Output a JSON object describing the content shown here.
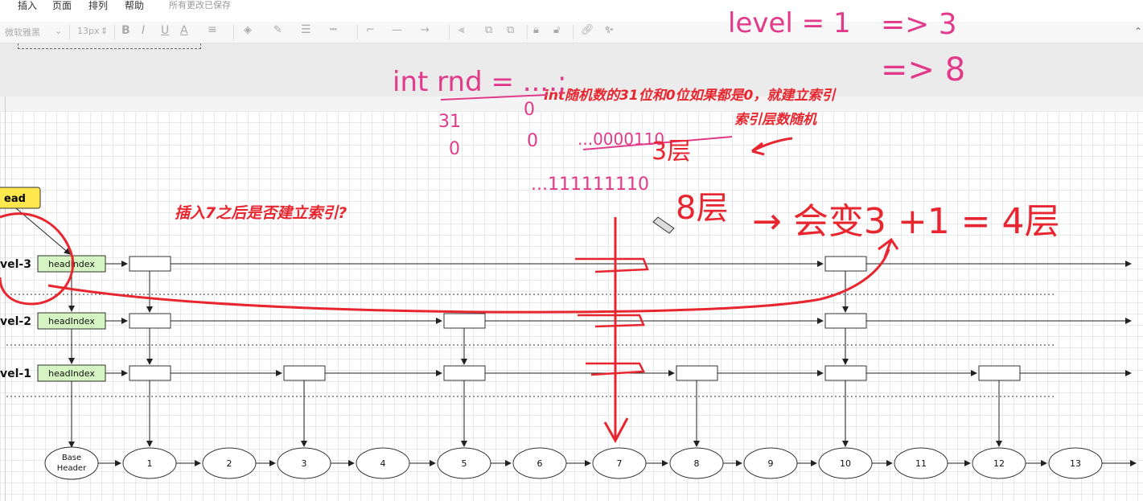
{
  "menu": {
    "items": [
      "插入",
      "页面",
      "排列",
      "帮助"
    ],
    "status": "所有更改已保存"
  },
  "toolbar": {
    "font_name": "微软雅黑",
    "font_size": "13px",
    "bold_icon": "B",
    "italic_icon": "I",
    "underline_icon": "U",
    "font_color_icon": "A"
  },
  "diagram": {
    "head_label": "ead",
    "level_labels": [
      "vel-3",
      "vel-2",
      "vel-1"
    ],
    "head_index_label": "headIndex",
    "base_header": [
      "Base",
      "Header"
    ],
    "nodes": [
      "1",
      "2",
      "3",
      "4",
      "5",
      "6",
      "7",
      "8",
      "9",
      "10",
      "11",
      "12",
      "13"
    ]
  },
  "annotations": {
    "typed_line1": "int随机数的31位和0位如果都是0，就建立索引",
    "typed_line2": "索引层数随机",
    "question": "插入7之后是否建立索引?",
    "handwritten": {
      "level": "level = 1",
      "arrow3": "=> 3",
      "arrow8": "=> 8",
      "rnd": "int rnd = ....;",
      "bit31": "31",
      "bit0": "0",
      "zero_a": "0",
      "zero_b": "0",
      "bits1": "...0000110",
      "bits2": "...111111110",
      "layer3": "3层",
      "layer8": "8层",
      "result": "→ 会变3 +1 = 4层"
    }
  },
  "colors": {
    "accent_red": "#e8262f",
    "pen_pink": "#e23a8a",
    "head_yellow": "#ffe84d",
    "index_green": "#d5f5c2"
  }
}
